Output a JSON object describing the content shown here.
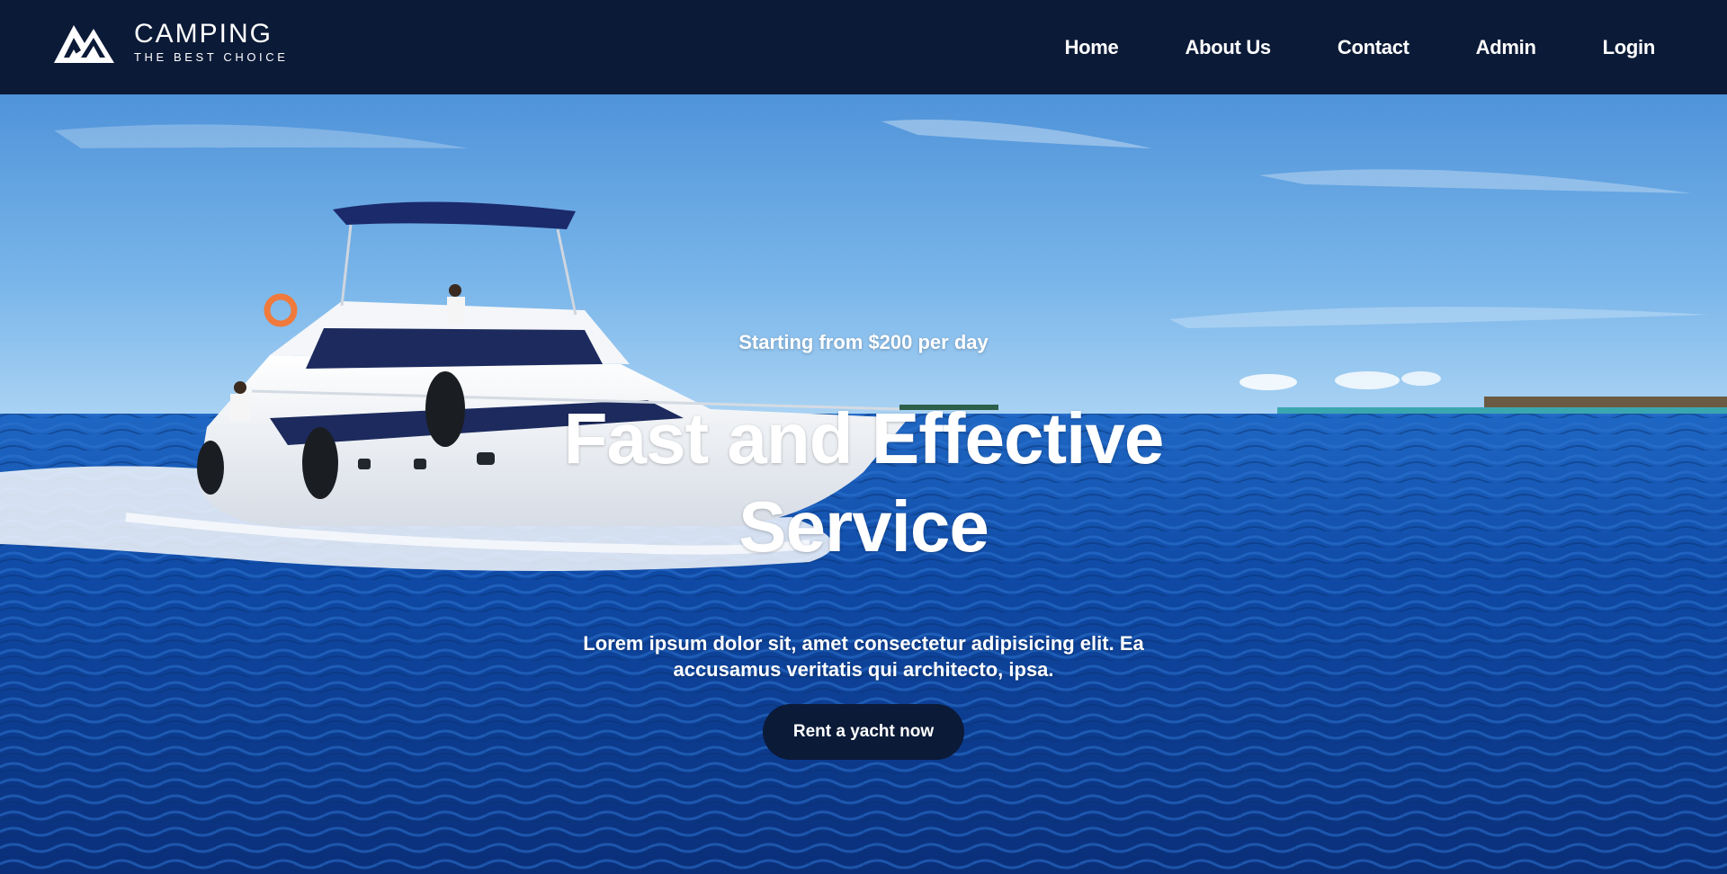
{
  "brand": {
    "name": "CAMPING",
    "tagline": "THE BEST CHOICE",
    "logo_icon": "mountain-logo-icon"
  },
  "nav": {
    "items": [
      {
        "label": "Home"
      },
      {
        "label": "About Us"
      },
      {
        "label": "Contact"
      },
      {
        "label": "Admin"
      },
      {
        "label": "Login"
      }
    ]
  },
  "hero": {
    "kicker": "Starting from $200 per day",
    "title": "Fast and Effective Service",
    "description": "Lorem ipsum dolor sit, amet consectetur adipisicing elit. Ea accusamus veritatis qui architecto, ipsa.",
    "cta_label": "Rent a yacht now",
    "background": "yacht-on-ocean-photo"
  },
  "colors": {
    "navbar_bg": "#0b1a37",
    "text": "#ffffff",
    "sky": "#5a9fe0",
    "ocean": "#0f4aa6"
  }
}
